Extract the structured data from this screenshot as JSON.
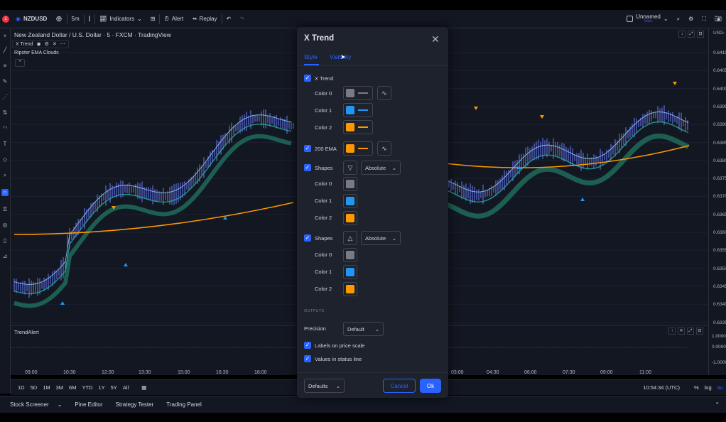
{
  "topbar": {
    "symbol": "NZDUSD",
    "interval": "5m",
    "indicators": "Indicators",
    "alert": "Alert",
    "replay": "Replay",
    "layout_name": "Unnamed",
    "layout_status": "Save",
    "notification_count": "1"
  },
  "chart": {
    "title": "New Zealand Dollar / U.S. Dollar · 5 · FXCM · TradingView",
    "legend": [
      {
        "name": "X Trend"
      },
      {
        "name": "Ripster EMA Clouds"
      }
    ],
    "pane2_title": "TrendAlert",
    "currency": "USD",
    "price_labels": [
      "0.6410",
      "0.6405",
      "0.6400",
      "0.6395",
      "0.6390",
      "0.6385",
      "0.6380",
      "0.6375",
      "0.6370",
      "0.6365",
      "0.6360",
      "0.6355",
      "0.6350",
      "0.6345",
      "0.6340",
      "0.6335"
    ],
    "pane2_labels": [
      "1.0000",
      "0.0000",
      "-1.0000"
    ],
    "time_labels": [
      "09:00",
      "10:30",
      "12:00",
      "13:30",
      "15:00",
      "16:30",
      "18:00",
      "03:00",
      "04:30",
      "06:00",
      "07:30",
      "09:00",
      "11:00"
    ],
    "time_label_tail": "00"
  },
  "colors": {
    "bg": "#131722",
    "accent": "#2962ff",
    "grey": "#787b86",
    "blue": "#2196f3",
    "orange": "#ff9800"
  },
  "rangebar": {
    "ranges": [
      "1D",
      "5D",
      "1M",
      "3M",
      "6M",
      "YTD",
      "1Y",
      "5Y",
      "All"
    ],
    "clock": "10:54:34 (UTC)",
    "pct": "%",
    "log": "log",
    "auto": "au"
  },
  "bottombar": {
    "tabs": [
      "Stock Screener",
      "Pine Editor",
      "Strategy Tester",
      "Trading Panel"
    ]
  },
  "dialog": {
    "title": "X Trend",
    "tabs": [
      "Style",
      "Visibility"
    ],
    "xtrend": {
      "label": "X Trend",
      "colors": [
        "Color 0",
        "Color 1",
        "Color 2"
      ]
    },
    "ema": {
      "label": "200 EMA"
    },
    "shapes1": {
      "label": "Shapes",
      "mode": "Absolute",
      "colors": [
        "Color 0",
        "Color 1",
        "Color 2"
      ]
    },
    "shapes2": {
      "label": "Shapes",
      "mode": "Absolute",
      "colors": [
        "Color 0",
        "Color 1",
        "Color 2"
      ]
    },
    "outputs_header": "OUTPUTS",
    "precision_label": "Precision",
    "precision_value": "Default",
    "labels_on_scale": "Labels on price scale",
    "values_in_status": "Values in status line",
    "defaults": "Defaults",
    "cancel": "Cancel",
    "ok": "Ok"
  }
}
